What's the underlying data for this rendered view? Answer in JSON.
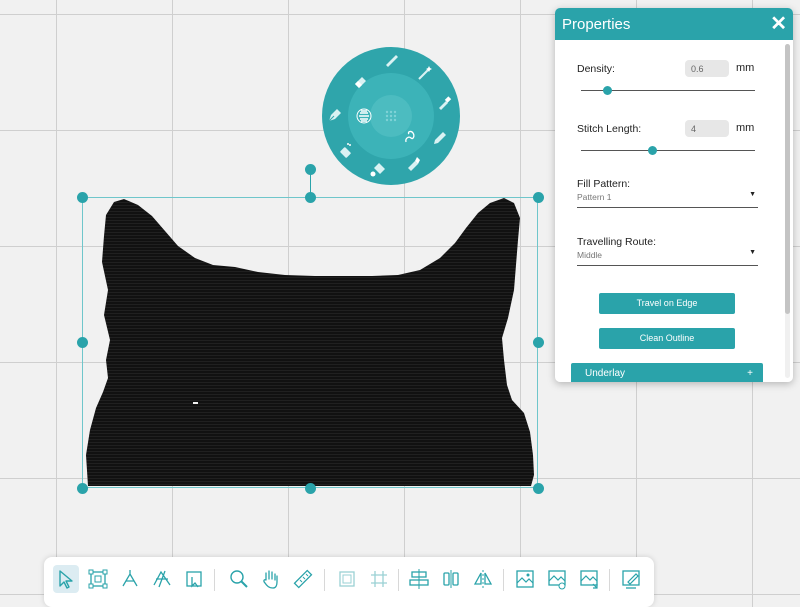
{
  "properties_panel": {
    "title": "Properties",
    "close_glyph": "✕",
    "density": {
      "label": "Density:",
      "value": "0.6",
      "unit": "mm",
      "slider_fraction": 0.15
    },
    "stitch_length": {
      "label": "Stitch Length:",
      "value": "4",
      "unit": "mm",
      "slider_fraction": 0.41
    },
    "fill_pattern": {
      "label": "Fill Pattern:",
      "selected": "Pattern 1"
    },
    "travelling_route": {
      "label": "Travelling Route:",
      "selected": "Middle"
    },
    "buttons": {
      "travel_on_edge": "Travel on Edge",
      "clean_outline": "Clean Outline"
    },
    "underlay": {
      "label": "Underlay",
      "expand_glyph": "+"
    },
    "scroll_fraction": 0.0
  },
  "stitch_wheel": {
    "items": [
      "pen-icon",
      "wand-icon",
      "brush-icon",
      "pencil-icon",
      "marker-icon",
      "fill-bucket-icon",
      "spray-icon",
      "pen-nib-icon",
      "eraser-icon"
    ],
    "center_items": [
      "satin-stitch-icon",
      "grid-stitch-icon",
      "running-stitch-icon"
    ]
  },
  "toolbar": {
    "tools": [
      {
        "icon": "select-arrow-icon",
        "active": true
      },
      {
        "icon": "node-edit-icon",
        "active": false
      },
      {
        "icon": "knife-cut-icon",
        "active": false
      },
      {
        "icon": "reshape-icon",
        "active": false
      },
      {
        "icon": "crop-icon",
        "active": false
      },
      {
        "icon": "zoom-icon",
        "active": false
      },
      {
        "icon": "pan-hand-icon",
        "active": false
      },
      {
        "icon": "ruler-icon",
        "active": false
      },
      {
        "icon": "group-icon",
        "active": false
      },
      {
        "icon": "ungroup-icon",
        "active": false
      },
      {
        "icon": "align-icon",
        "active": false
      },
      {
        "icon": "distribute-icon",
        "active": false
      },
      {
        "icon": "mirror-icon",
        "active": false
      },
      {
        "icon": "image-trace-icon",
        "active": false
      },
      {
        "icon": "image-view-icon",
        "active": false
      },
      {
        "icon": "image-export-icon",
        "active": false
      },
      {
        "icon": "design-edit-icon",
        "active": false
      }
    ]
  },
  "colors": {
    "accent": "#2aa3aa",
    "shape_fill": "#111111",
    "canvas_bg": "#f1f1f1",
    "grid": "#cfcfcf"
  }
}
